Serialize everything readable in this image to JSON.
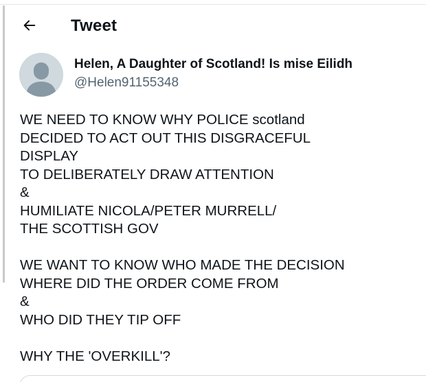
{
  "header": {
    "title": "Tweet",
    "back_icon": "arrow-left-icon"
  },
  "author": {
    "display_name": "Helen, A Daughter of Scotland! Is mise Eilidh",
    "handle": "@Helen91155348",
    "avatar_icon": "default-user-avatar-icon"
  },
  "tweet": {
    "text": "WE NEED TO KNOW WHY POLICE scotland\nDECIDED TO ACT OUT THIS DISGRACEFUL\nDISPLAY\nTO DELIBERATELY DRAW ATTENTION\n&\nHUMILIATE NICOLA/PETER MURRELL/\nTHE SCOTTISH GOV\n\nWE WANT TO KNOW WHO MADE THE DECISION\nWHERE DID THE ORDER COME FROM\n&\nWHO DID THEY TIP OFF\n\nWHY THE 'OVERKILL'?"
  },
  "colors": {
    "text": "#0f1419",
    "secondary_text": "#536471",
    "avatar_bg": "#cfd9de",
    "avatar_fg": "#8899a6"
  }
}
